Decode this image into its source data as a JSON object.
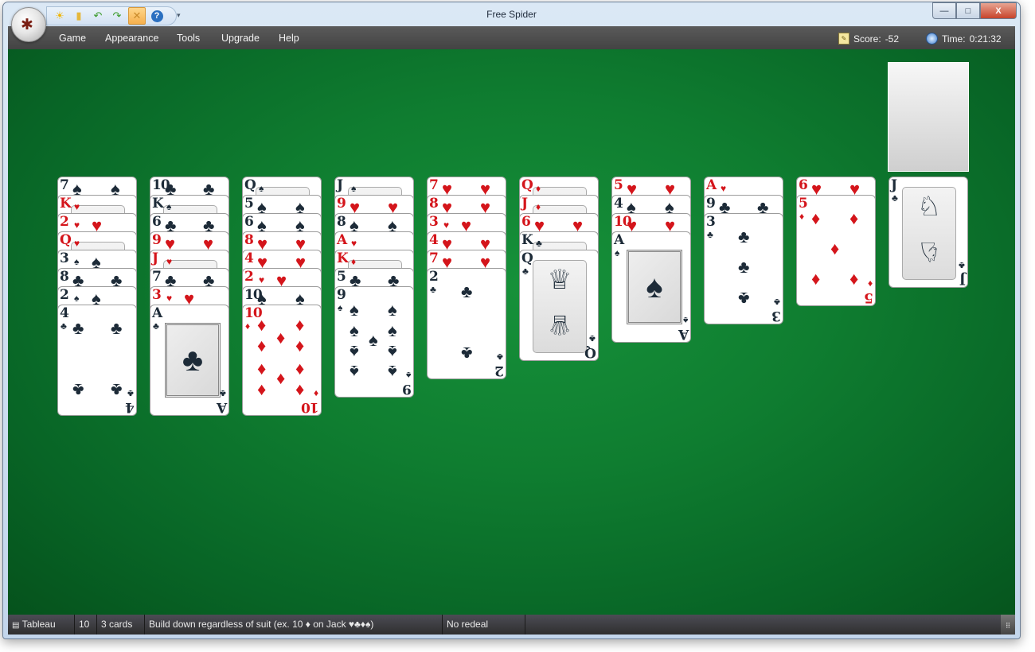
{
  "window": {
    "title": "Free Spider",
    "controls": {
      "minimize": "—",
      "maximize": "□",
      "close": "X"
    }
  },
  "quick_access": [
    {
      "name": "new-game",
      "icon": "sun-icon",
      "glyph": "☀"
    },
    {
      "name": "open",
      "icon": "folder-icon",
      "glyph": "▮"
    },
    {
      "name": "undo",
      "icon": "undo-arrow-icon",
      "glyph": "↶"
    },
    {
      "name": "redo",
      "icon": "redo-arrow-icon",
      "glyph": "↷"
    },
    {
      "name": "hint",
      "icon": "hint-icon",
      "glyph": "✕",
      "active": true
    },
    {
      "name": "help",
      "icon": "help-icon",
      "glyph": "?"
    }
  ],
  "menu": [
    "Game",
    "Appearance",
    "Tools",
    "Upgrade",
    "Help"
  ],
  "score": {
    "label": "Score:",
    "value": "-52"
  },
  "time": {
    "label": "Time:",
    "value": "0:21:32"
  },
  "tableau": [
    {
      "cards": [
        {
          "rank": "7",
          "suit": "♠"
        },
        {
          "rank": "K",
          "suit": "♥"
        },
        {
          "rank": "2",
          "suit": "♥"
        },
        {
          "rank": "Q",
          "suit": "♥"
        },
        {
          "rank": "3",
          "suit": "♠"
        },
        {
          "rank": "8",
          "suit": "♣"
        },
        {
          "rank": "2",
          "suit": "♠"
        },
        {
          "rank": "4",
          "suit": "♣"
        }
      ]
    },
    {
      "cards": [
        {
          "rank": "10",
          "suit": "♣"
        },
        {
          "rank": "K",
          "suit": "♠"
        },
        {
          "rank": "6",
          "suit": "♣"
        },
        {
          "rank": "9",
          "suit": "♥"
        },
        {
          "rank": "J",
          "suit": "♥"
        },
        {
          "rank": "7",
          "suit": "♣"
        },
        {
          "rank": "3",
          "suit": "♥"
        },
        {
          "rank": "A",
          "suit": "♣"
        }
      ]
    },
    {
      "cards": [
        {
          "rank": "Q",
          "suit": "♠"
        },
        {
          "rank": "5",
          "suit": "♠"
        },
        {
          "rank": "6",
          "suit": "♠"
        },
        {
          "rank": "8",
          "suit": "♥"
        },
        {
          "rank": "4",
          "suit": "♥"
        },
        {
          "rank": "2",
          "suit": "♥"
        },
        {
          "rank": "10",
          "suit": "♠"
        },
        {
          "rank": "10",
          "suit": "♦"
        }
      ]
    },
    {
      "cards": [
        {
          "rank": "J",
          "suit": "♠"
        },
        {
          "rank": "9",
          "suit": "♥"
        },
        {
          "rank": "8",
          "suit": "♠"
        },
        {
          "rank": "A",
          "suit": "♥"
        },
        {
          "rank": "K",
          "suit": "♦"
        },
        {
          "rank": "5",
          "suit": "♣"
        },
        {
          "rank": "9",
          "suit": "♠"
        }
      ]
    },
    {
      "cards": [
        {
          "rank": "7",
          "suit": "♥"
        },
        {
          "rank": "8",
          "suit": "♥"
        },
        {
          "rank": "3",
          "suit": "♥"
        },
        {
          "rank": "4",
          "suit": "♥"
        },
        {
          "rank": "7",
          "suit": "♥"
        },
        {
          "rank": "2",
          "suit": "♣"
        }
      ]
    },
    {
      "cards": [
        {
          "rank": "Q",
          "suit": "♦"
        },
        {
          "rank": "J",
          "suit": "♦"
        },
        {
          "rank": "6",
          "suit": "♥"
        },
        {
          "rank": "K",
          "suit": "♣"
        },
        {
          "rank": "Q",
          "suit": "♣"
        }
      ]
    },
    {
      "cards": [
        {
          "rank": "5",
          "suit": "♥"
        },
        {
          "rank": "4",
          "suit": "♠"
        },
        {
          "rank": "10",
          "suit": "♥"
        },
        {
          "rank": "A",
          "suit": "♠"
        }
      ]
    },
    {
      "cards": [
        {
          "rank": "A",
          "suit": "♥"
        },
        {
          "rank": "9",
          "suit": "♣"
        },
        {
          "rank": "3",
          "suit": "♣"
        }
      ]
    },
    {
      "cards": [
        {
          "rank": "6",
          "suit": "♥"
        },
        {
          "rank": "5",
          "suit": "♦"
        }
      ]
    },
    {
      "cards": [
        {
          "rank": "J",
          "suit": "♣"
        }
      ]
    }
  ],
  "stock": {
    "label": "stock"
  },
  "status": {
    "pile": "Tableau",
    "count": "10",
    "cards": "3 cards",
    "rule": "Build down regardless of suit (ex. 10 ♦ on Jack ♥♣♦♠)",
    "redeal": "No redeal"
  }
}
